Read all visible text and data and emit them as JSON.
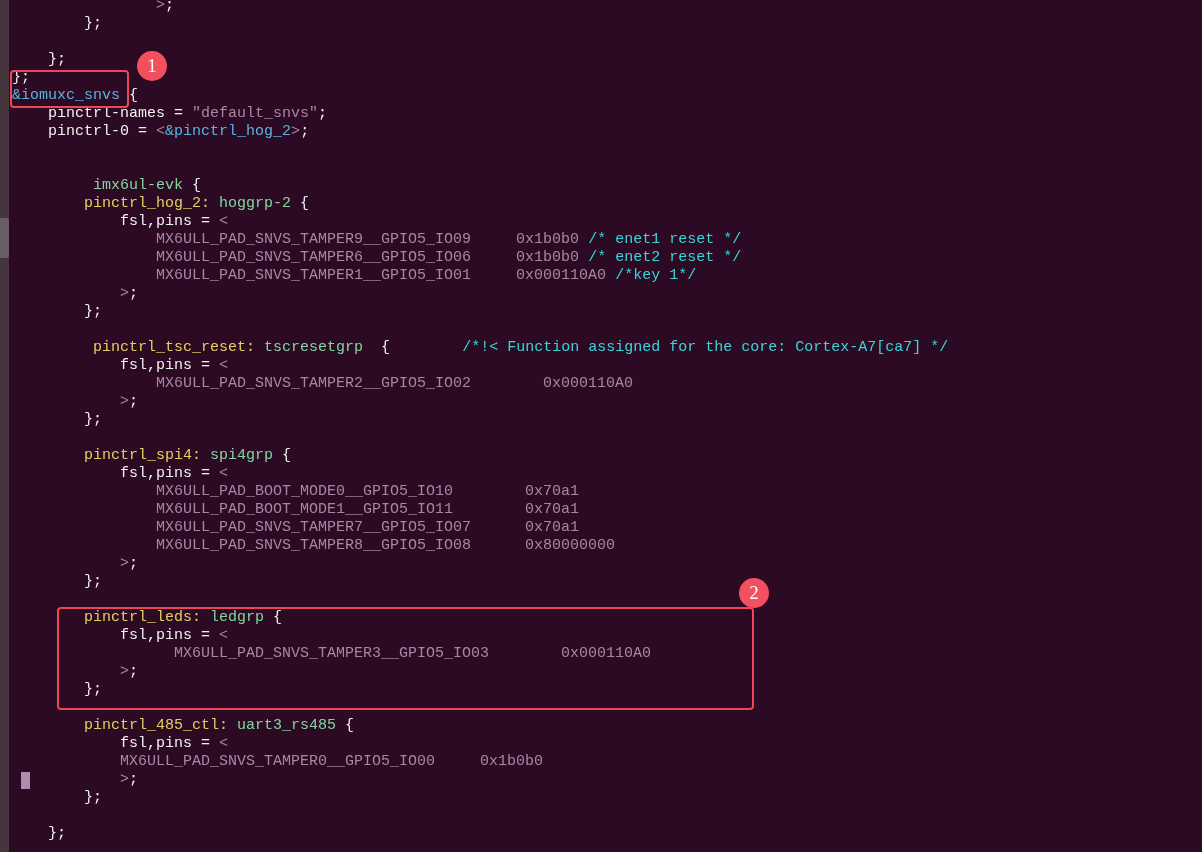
{
  "editor": {
    "lines": [
      {
        "kind": "code",
        "tokens": [
          {
            "kind": "literal",
            "text": "                >"
          },
          {
            "kind": "plain",
            "text": ";"
          }
        ]
      },
      {
        "kind": "code",
        "tokens": [
          {
            "kind": "plain",
            "text": "        };"
          }
        ]
      },
      {
        "kind": "blank"
      },
      {
        "kind": "code",
        "tokens": [
          {
            "kind": "plain",
            "text": "    };"
          }
        ]
      },
      {
        "kind": "code",
        "tokens": [
          {
            "kind": "plain",
            "text": "};"
          }
        ]
      },
      {
        "kind": "code",
        "tokens": [
          {
            "kind": "ref",
            "text": "&iomuxc_snvs"
          },
          {
            "kind": "plain",
            "text": " {"
          }
        ]
      },
      {
        "kind": "code",
        "tokens": [
          {
            "kind": "plain",
            "text": "    pinctrl-names ="
          },
          {
            "kind": "literal",
            "text": " \"default_snvs\""
          },
          {
            "kind": "plain",
            "text": ";"
          }
        ]
      },
      {
        "kind": "code",
        "tokens": [
          {
            "kind": "plain",
            "text": "    pinctrl-0 ="
          },
          {
            "kind": "literal",
            "text": " <"
          },
          {
            "kind": "ref",
            "text": "&pinctrl_hog_2"
          },
          {
            "kind": "literal",
            "text": ">"
          },
          {
            "kind": "plain",
            "text": ";"
          }
        ]
      },
      {
        "kind": "blank"
      },
      {
        "kind": "blank"
      },
      {
        "kind": "code",
        "tokens": [
          {
            "kind": "node",
            "text": "         imx6ul-evk"
          },
          {
            "kind": "plain",
            "text": " {"
          }
        ]
      },
      {
        "kind": "code",
        "tokens": [
          {
            "kind": "label",
            "text": "        pinctrl_hog_2:"
          },
          {
            "kind": "node",
            "text": " hoggrp-2"
          },
          {
            "kind": "plain",
            "text": " {"
          }
        ]
      },
      {
        "kind": "code",
        "tokens": [
          {
            "kind": "plain",
            "text": "            fsl,pins ="
          },
          {
            "kind": "literal",
            "text": " <"
          }
        ]
      },
      {
        "kind": "code",
        "tokens": [
          {
            "kind": "literal",
            "text": "                MX6ULL_PAD_SNVS_TAMPER9__GPIO5_IO09"
          },
          {
            "kind": "literal",
            "text": "     0x1b0b0"
          },
          {
            "kind": "comment",
            "text": " /* enet1 reset */"
          }
        ]
      },
      {
        "kind": "code",
        "tokens": [
          {
            "kind": "literal",
            "text": "                MX6ULL_PAD_SNVS_TAMPER6__GPIO5_IO06"
          },
          {
            "kind": "literal",
            "text": "     0x1b0b0"
          },
          {
            "kind": "comment",
            "text": " /* enet2 reset */"
          }
        ]
      },
      {
        "kind": "code",
        "tokens": [
          {
            "kind": "literal",
            "text": "                MX6ULL_PAD_SNVS_TAMPER1__GPIO5_IO01"
          },
          {
            "kind": "literal",
            "text": "     0x000110A0"
          },
          {
            "kind": "comment",
            "text": " /*key 1*/"
          }
        ]
      },
      {
        "kind": "code",
        "tokens": [
          {
            "kind": "literal",
            "text": "            >"
          },
          {
            "kind": "plain",
            "text": ";"
          }
        ]
      },
      {
        "kind": "code",
        "tokens": [
          {
            "kind": "plain",
            "text": "        };"
          }
        ]
      },
      {
        "kind": "blank"
      },
      {
        "kind": "code",
        "tokens": [
          {
            "kind": "label",
            "text": "         pinctrl_tsc_reset:"
          },
          {
            "kind": "node",
            "text": " tscresetgrp"
          },
          {
            "kind": "plain",
            "text": "  {"
          },
          {
            "kind": "comment",
            "text": "        /*!< Function assigned for the core: Cortex-A7[ca7] */"
          }
        ]
      },
      {
        "kind": "code",
        "tokens": [
          {
            "kind": "plain",
            "text": "            fsl,pins ="
          },
          {
            "kind": "literal",
            "text": " <"
          }
        ]
      },
      {
        "kind": "code",
        "tokens": [
          {
            "kind": "literal",
            "text": "                MX6ULL_PAD_SNVS_TAMPER2__GPIO5_IO02"
          },
          {
            "kind": "literal",
            "text": "        0x000110A0"
          }
        ]
      },
      {
        "kind": "code",
        "tokens": [
          {
            "kind": "literal",
            "text": "            >"
          },
          {
            "kind": "plain",
            "text": ";"
          }
        ]
      },
      {
        "kind": "code",
        "tokens": [
          {
            "kind": "plain",
            "text": "        };"
          }
        ]
      },
      {
        "kind": "blank"
      },
      {
        "kind": "code",
        "tokens": [
          {
            "kind": "label",
            "text": "        pinctrl_spi4:"
          },
          {
            "kind": "node",
            "text": " spi4grp"
          },
          {
            "kind": "plain",
            "text": " {"
          }
        ]
      },
      {
        "kind": "code",
        "tokens": [
          {
            "kind": "plain",
            "text": "            fsl,pins ="
          },
          {
            "kind": "literal",
            "text": " <"
          }
        ]
      },
      {
        "kind": "code",
        "tokens": [
          {
            "kind": "literal",
            "text": "                MX6ULL_PAD_BOOT_MODE0__GPIO5_IO10"
          },
          {
            "kind": "literal",
            "text": "        0x70a1"
          }
        ]
      },
      {
        "kind": "code",
        "tokens": [
          {
            "kind": "literal",
            "text": "                MX6ULL_PAD_BOOT_MODE1__GPIO5_IO11"
          },
          {
            "kind": "literal",
            "text": "        0x70a1"
          }
        ]
      },
      {
        "kind": "code",
        "tokens": [
          {
            "kind": "literal",
            "text": "                MX6ULL_PAD_SNVS_TAMPER7__GPIO5_IO07"
          },
          {
            "kind": "literal",
            "text": "      0x70a1"
          }
        ]
      },
      {
        "kind": "code",
        "tokens": [
          {
            "kind": "literal",
            "text": "                MX6ULL_PAD_SNVS_TAMPER8__GPIO5_IO08"
          },
          {
            "kind": "literal",
            "text": "      0x80000000"
          }
        ]
      },
      {
        "kind": "code",
        "tokens": [
          {
            "kind": "literal",
            "text": "            >"
          },
          {
            "kind": "plain",
            "text": ";"
          }
        ]
      },
      {
        "kind": "code",
        "tokens": [
          {
            "kind": "plain",
            "text": "        };"
          }
        ]
      },
      {
        "kind": "blank"
      },
      {
        "kind": "code",
        "tokens": [
          {
            "kind": "label",
            "text": "        pinctrl_leds:"
          },
          {
            "kind": "node",
            "text": " ledgrp"
          },
          {
            "kind": "plain",
            "text": " {"
          }
        ]
      },
      {
        "kind": "code",
        "tokens": [
          {
            "kind": "plain",
            "text": "            fsl,pins ="
          },
          {
            "kind": "literal",
            "text": " <"
          }
        ]
      },
      {
        "kind": "code",
        "tokens": [
          {
            "kind": "literal",
            "text": "                  MX6ULL_PAD_SNVS_TAMPER3__GPIO5_IO03"
          },
          {
            "kind": "literal",
            "text": "        0x000110A0"
          }
        ]
      },
      {
        "kind": "code",
        "tokens": [
          {
            "kind": "literal",
            "text": "            >"
          },
          {
            "kind": "plain",
            "text": ";"
          }
        ]
      },
      {
        "kind": "code",
        "tokens": [
          {
            "kind": "plain",
            "text": "        };"
          }
        ]
      },
      {
        "kind": "blank"
      },
      {
        "kind": "code",
        "tokens": [
          {
            "kind": "label",
            "text": "        pinctrl_485_ctl:"
          },
          {
            "kind": "node",
            "text": " uart3_rs485"
          },
          {
            "kind": "plain",
            "text": " {"
          }
        ]
      },
      {
        "kind": "code",
        "tokens": [
          {
            "kind": "plain",
            "text": "            fsl,pins ="
          },
          {
            "kind": "literal",
            "text": " <"
          }
        ]
      },
      {
        "kind": "code",
        "tokens": [
          {
            "kind": "literal",
            "text": "            MX6ULL_PAD_SNVS_TAMPER0__GPIO5_IO00"
          },
          {
            "kind": "literal",
            "text": "     0x1b0b0"
          }
        ]
      },
      {
        "kind": "code",
        "tokens": [
          {
            "kind": "cursor"
          },
          {
            "kind": "literal",
            "text": "          >"
          },
          {
            "kind": "plain",
            "text": ";"
          }
        ]
      },
      {
        "kind": "code",
        "tokens": [
          {
            "kind": "plain",
            "text": "        };"
          }
        ]
      },
      {
        "kind": "blank"
      },
      {
        "kind": "code",
        "tokens": [
          {
            "kind": "plain",
            "text": "    };"
          }
        ]
      }
    ]
  },
  "annotations": [
    {
      "number": "1"
    },
    {
      "number": "2"
    }
  ]
}
